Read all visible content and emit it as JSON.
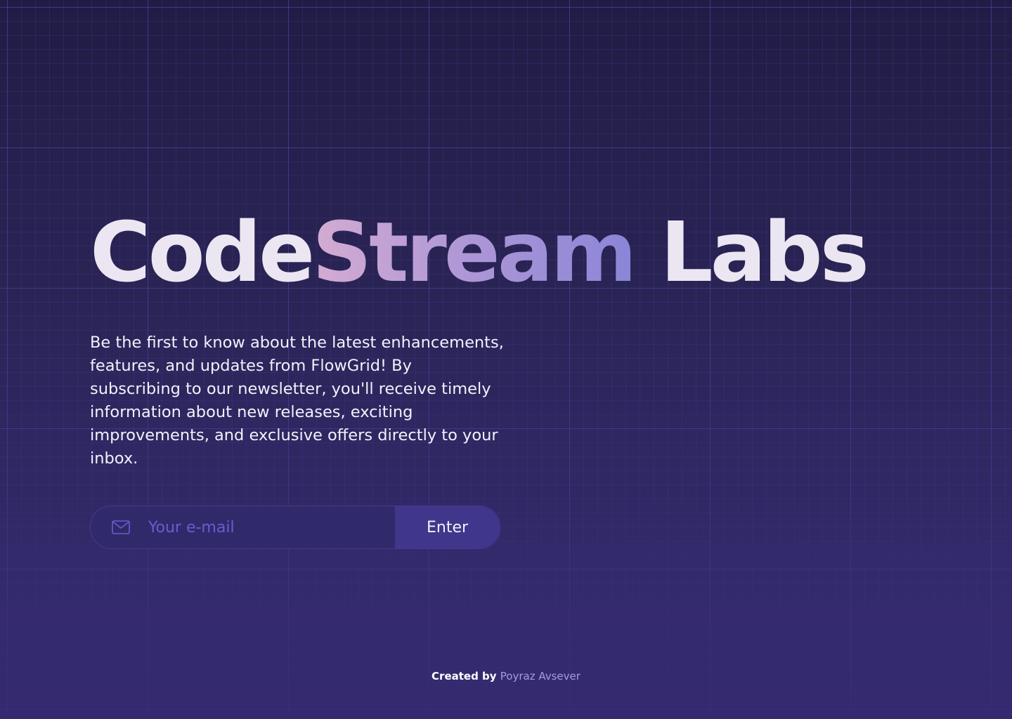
{
  "hero": {
    "title_part1": "Code",
    "title_accent": "Stream",
    "title_part2": " Labs",
    "description": "Be the first to know about the latest enhancements, features, and updates from FlowGrid! By subscribing to our newsletter, you'll receive timely information about new releases, exciting improvements, and exclusive offers directly to your inbox."
  },
  "subscribe": {
    "email_placeholder": "Your e-mail",
    "email_value": "",
    "email_icon": "mail-icon",
    "button_label": "Enter"
  },
  "footer": {
    "label": "Created by",
    "author": "Poyraz Avsever"
  },
  "colors": {
    "background_top": "#211c45",
    "background_bottom": "#352a70",
    "grid_line": "#5c52c8",
    "title_text": "#ece6f2",
    "title_accent_start": "#d4acd2",
    "title_accent_end": "#8a85d8",
    "input_background": "#312a6a",
    "placeholder_text": "#6a5ccd",
    "button_background": "#40378c",
    "footer_author": "#a89be0"
  }
}
